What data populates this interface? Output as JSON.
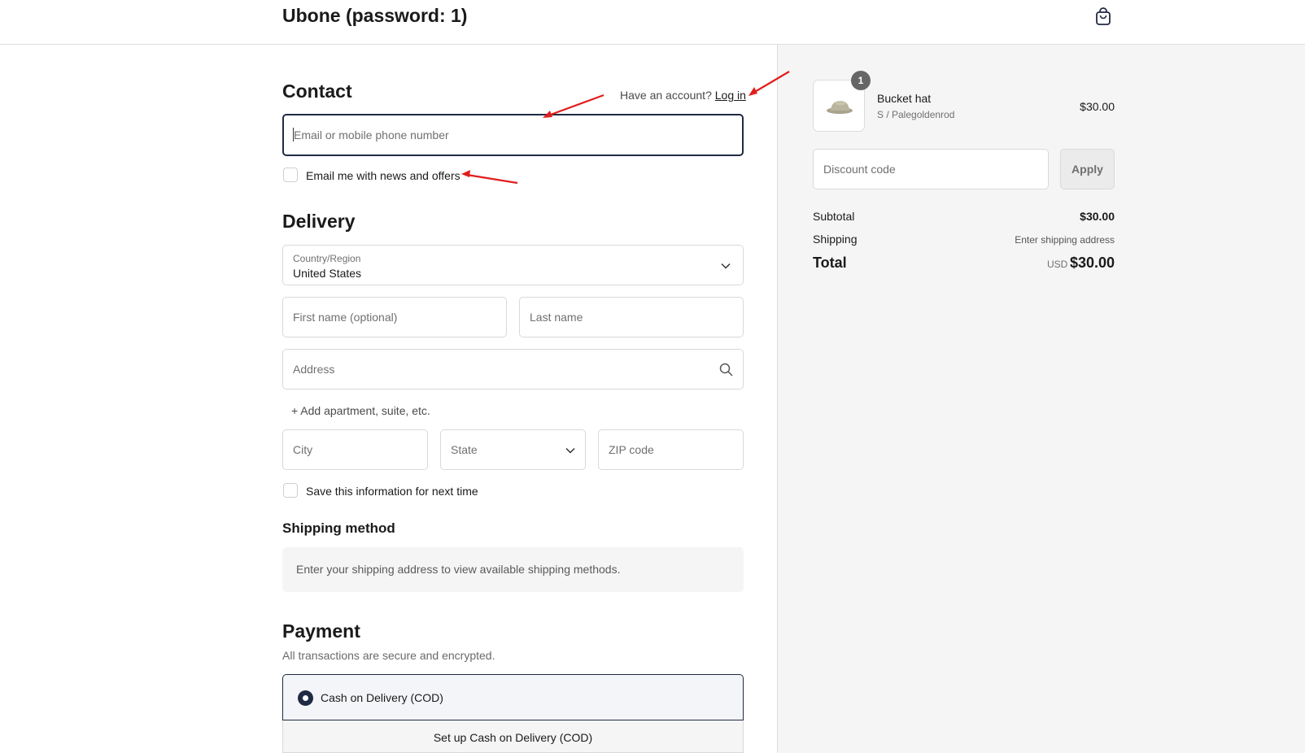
{
  "header": {
    "title": "Ubone (password: 1)",
    "cart_icon": "shopping-bag-icon"
  },
  "contact": {
    "heading": "Contact",
    "account_prompt": "Have an account?",
    "login_link": "Log in",
    "email_placeholder": "Email or mobile phone number",
    "news_checkbox_label": "Email me with news and offers"
  },
  "delivery": {
    "heading": "Delivery",
    "country_label": "Country/Region",
    "country_value": "United States",
    "first_name_placeholder": "First name (optional)",
    "last_name_placeholder": "Last name",
    "address_placeholder": "Address",
    "add_apartment": "+ Add apartment, suite, etc.",
    "city_placeholder": "City",
    "state_placeholder": "State",
    "zip_placeholder": "ZIP code",
    "save_info_label": "Save this information for next time"
  },
  "shipping": {
    "heading": "Shipping method",
    "info": "Enter your shipping address to view available shipping methods."
  },
  "payment": {
    "heading": "Payment",
    "subtitle": "All transactions are secure and encrypted.",
    "selected_option": "Cash on Delivery (COD)",
    "option_detail": "Set up Cash on Delivery (COD)"
  },
  "summary": {
    "item": {
      "quantity": "1",
      "name": "Bucket hat",
      "variant": "S / Palegoldenrod",
      "price": "$30.00"
    },
    "discount_placeholder": "Discount code",
    "apply_label": "Apply",
    "subtotal_label": "Subtotal",
    "subtotal_value": "$30.00",
    "shipping_label": "Shipping",
    "shipping_value": "Enter shipping address",
    "total_label": "Total",
    "total_currency": "USD",
    "total_value": "$30.00"
  },
  "colors": {
    "accent": "#1f2a44",
    "annotation": "#e11d1d",
    "sidebar_bg": "#f5f5f5"
  }
}
